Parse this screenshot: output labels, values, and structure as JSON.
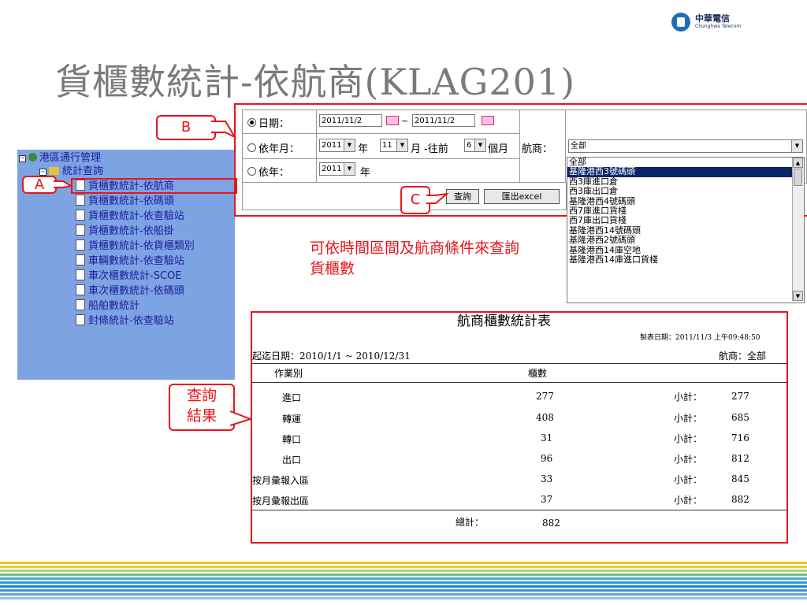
{
  "logo": {
    "name_cn": "中華電信",
    "name_en": "Chunghwa Telecom"
  },
  "page_title": "貨櫃數統計-依航商(KLAG201)",
  "tree": {
    "root": "港區通行管理",
    "folder": "統計查詢",
    "items": [
      "貨櫃數統計-依航商",
      "貨櫃數統計-依碼頭",
      "貨櫃數統計-依查驗站",
      "貨櫃數統計-依船掛",
      "貨櫃數統計-依貨櫃類別",
      "車輛數統計-依查驗站",
      "車次櫃數統計-SCOE",
      "車次櫃數統計-依碼頭",
      "船舶數統計",
      "封條統計-依查驗站"
    ]
  },
  "callouts": {
    "a": "A",
    "b": "B",
    "c": "C",
    "result_line1": "查詢",
    "result_line2": "結果"
  },
  "form": {
    "date_label": "日期：",
    "date_from": "2011/11/2",
    "date_sep": "~",
    "date_to": "2011/11/2",
    "month_label": "依年月：",
    "month_year": "2011",
    "year_unit": "年",
    "month_value": "11",
    "month_unit": "月 -往前",
    "months_back": "6",
    "months_unit": "個月",
    "year_label": "依年：",
    "year_value": "2011",
    "year_unit2": "年",
    "query_button": "查詢",
    "export_button": "匯出excel",
    "carrier_label": "航商：",
    "carrier_selected": "全部",
    "carrier_options": [
      "全部",
      "基隆港西3號碼頭",
      "西3庫進口倉",
      "西3庫出口倉",
      "基隆港西4號碼頭",
      "西7庫進口貨棧",
      "西7庫出口貨棧",
      "基隆港西14號碼頭",
      "基隆港西2號碼頭",
      "基隆港西14庫空地",
      "基隆港西14庫進口貨棧"
    ]
  },
  "note": "可依時間區間及航商條件來查詢貨櫃數",
  "report": {
    "title": "航商櫃數統計表",
    "print_date": "製表日期：2011/11/3 上午09:48:50",
    "period": "起迄日期：2010/1/1 ~ 2010/12/31",
    "carrier": "航商：全部",
    "col_type": "作業別",
    "col_count": "櫃數",
    "subtotal_label": "小計：",
    "rows": [
      {
        "type": "進口",
        "count": "277",
        "subtotal": "277"
      },
      {
        "type": "轉運",
        "count": "408",
        "subtotal": "685"
      },
      {
        "type": "轉口",
        "count": "31",
        "subtotal": "716"
      },
      {
        "type": "出口",
        "count": "96",
        "subtotal": "812"
      },
      {
        "type": "按月彙報入區",
        "count": "33",
        "subtotal": "845"
      },
      {
        "type": "按月彙報出區",
        "count": "37",
        "subtotal": "882"
      }
    ],
    "total_label": "總計：",
    "total": "882"
  },
  "colors": {
    "accent_red": "#e8141a",
    "tree_bg": "#7ea3e3",
    "title_gray": "#7a7a7a"
  }
}
